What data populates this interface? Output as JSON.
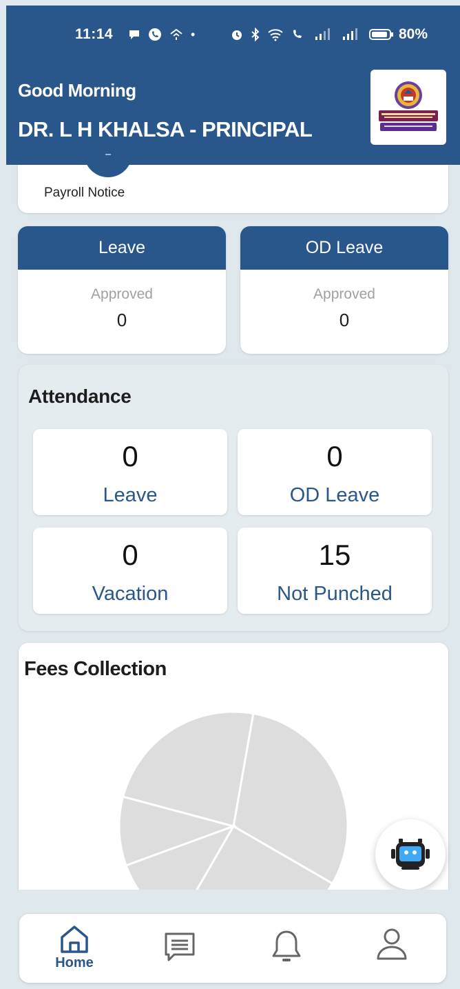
{
  "status_bar": {
    "time": "11:14",
    "battery": "80%"
  },
  "header": {
    "greeting": "Good Morning",
    "user_name": "DR. L H KHALSA - PRINCIPAL",
    "background_color": "#2a578b"
  },
  "payroll": {
    "label": "Payroll Notice"
  },
  "leave_cards": [
    {
      "title": "Leave",
      "status_label": "Approved",
      "value": "0"
    },
    {
      "title": "OD Leave",
      "status_label": "Approved",
      "value": "0"
    }
  ],
  "attendance": {
    "title": "Attendance",
    "tiles": [
      {
        "value": "0",
        "label": "Leave"
      },
      {
        "value": "0",
        "label": "OD Leave"
      },
      {
        "value": "0",
        "label": "Vacation"
      },
      {
        "value": "15",
        "label": "Not Punched"
      }
    ]
  },
  "fees": {
    "title": "Fees Collection",
    "chart_data": {
      "type": "pie",
      "title": "Fees Collection",
      "slice_color": "#dddddd",
      "slices_visible": 5
    }
  },
  "bottom_nav": {
    "items": [
      {
        "label": "Home",
        "icon": "home-icon",
        "active": true
      },
      {
        "label": "",
        "icon": "message-icon",
        "active": false
      },
      {
        "label": "",
        "icon": "bell-icon",
        "active": false
      },
      {
        "label": "",
        "icon": "profile-icon",
        "active": false
      }
    ]
  },
  "colors": {
    "primary": "#2a578b",
    "background": "#dfe8ec",
    "muted_text": "#a0a0a0"
  }
}
